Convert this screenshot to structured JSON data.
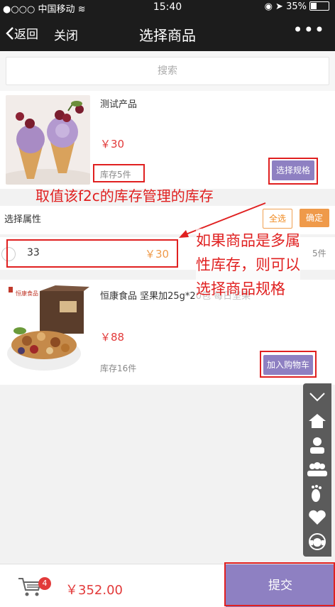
{
  "status": {
    "carrier": "中国移动",
    "time": "15:40",
    "battery": "35%",
    "battery_level": 0.35
  },
  "nav": {
    "back": "返回",
    "close": "关闭",
    "title": "选择商品",
    "more": "•••"
  },
  "search": {
    "placeholder": "搜索"
  },
  "product1": {
    "name": "测试产品",
    "price": "￥30",
    "stock": "库存5件",
    "button": "选择规格"
  },
  "attribute": {
    "label": "选择属性",
    "select_all": "全选",
    "confirm": "确定",
    "option_value": "33",
    "option_price": "￥30",
    "option_stock": "5件"
  },
  "product2": {
    "name": "恒康食品 坚果加25g*20包 每日坚果",
    "brand": "恒康食品",
    "price": "￥88",
    "stock": "库存16件",
    "button": "加入购物车"
  },
  "annotations": {
    "a1": "取值该f2c的库存管理的库存",
    "a2_line1": "如果商品是多属",
    "a2_line2": "性库存，则可以",
    "a2_line3": "选择商品规格"
  },
  "cart": {
    "count": "4",
    "total": "￥352.00",
    "submit": "提交"
  },
  "icons": [
    "chevron-down-icon",
    "home-icon",
    "person-icon",
    "group-icon",
    "footprint-icon",
    "heart-icon",
    "customer-service-icon"
  ],
  "colors": {
    "accent_purple": "#8e80c2",
    "price_red": "#e23a3a",
    "orange": "#ef9a4a",
    "annotation_red": "#e02020"
  }
}
